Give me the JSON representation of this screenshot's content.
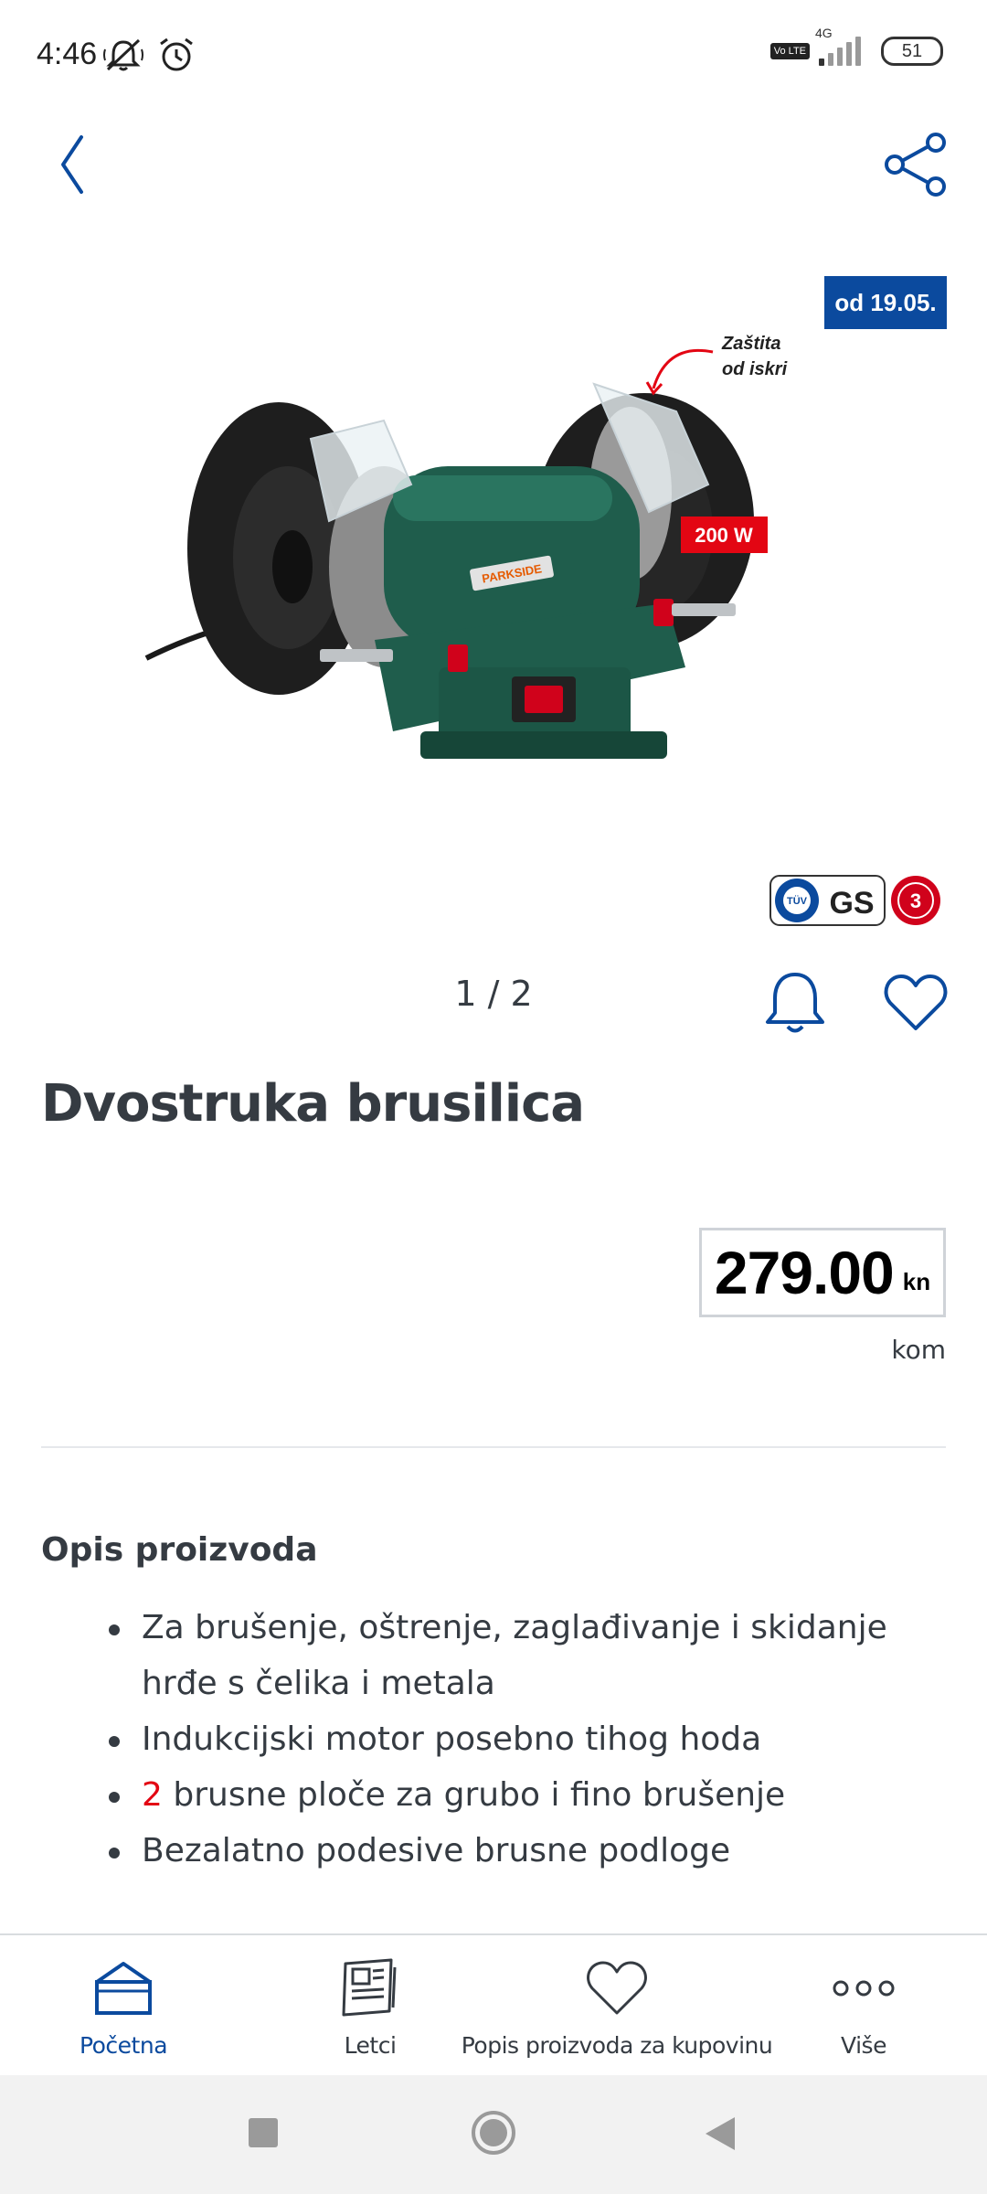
{
  "status_bar": {
    "time": "4:46",
    "volte": "Vo LTE",
    "network": "4G",
    "battery": "51"
  },
  "header": {
    "back_icon": "chevron-left-icon",
    "share_icon": "share-icon"
  },
  "product": {
    "availability_badge": "od 19.05.",
    "image_annotation_line1": "Zaštita",
    "image_annotation_line2": "od iskri",
    "image_power_label": "200 W",
    "image_brand_label": "PARKSIDE",
    "pager": "1 / 2",
    "title": "Dvostruka brusilica",
    "price": "279.00",
    "currency": "kn",
    "unit": "kom"
  },
  "description": {
    "heading": "Opis proizvoda",
    "items": [
      "Za brušenje, oštrenje, zaglađivanje i skidanje hrđe s čelika i metala",
      "Indukcijski motor posebno tihog hoda",
      "brusne ploče za grubo i fino brušenje",
      "Bezalatno podesive brusne podloge"
    ],
    "item3_number": "2"
  },
  "bottom_nav": {
    "items": [
      {
        "label": "Početna",
        "icon": "home-icon",
        "active": true
      },
      {
        "label": "Letci",
        "icon": "leaflet-icon",
        "active": false
      },
      {
        "label": "Popis proizvoda za kupovinu",
        "icon": "heart-icon",
        "active": false
      },
      {
        "label": "Više",
        "icon": "more-dots-icon",
        "active": false
      }
    ]
  },
  "colors": {
    "brand_blue": "#0b4a9e",
    "text_dark": "#353b42",
    "accent_red": "#e30613",
    "machine_green": "#1f5d4c"
  }
}
